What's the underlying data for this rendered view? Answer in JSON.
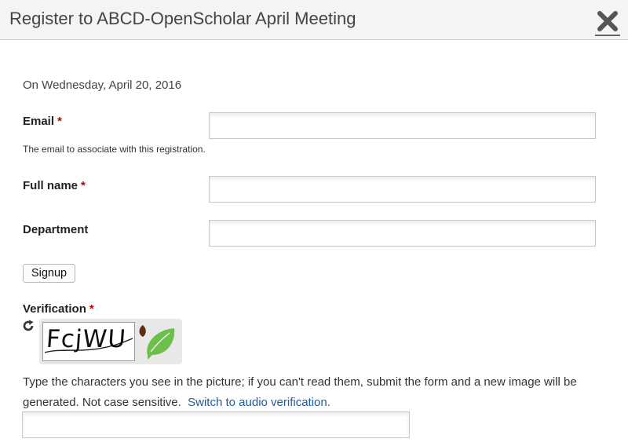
{
  "dialog": {
    "title": "Register to ABCD-OpenScholar April Meeting",
    "close_icon": "close-icon"
  },
  "event": {
    "date_line": "On Wednesday, April 20, 2016"
  },
  "form": {
    "required_marker": "*",
    "email": {
      "label": "Email",
      "required": true,
      "value": "",
      "help": "The email to associate with this registration."
    },
    "full_name": {
      "label": "Full name",
      "required": true,
      "value": ""
    },
    "department": {
      "label": "Department",
      "required": false,
      "value": ""
    },
    "signup_label": "Signup"
  },
  "verification": {
    "label": "Verification",
    "required": true,
    "refresh_icon": "refresh-icon",
    "captcha_text": "FcjWU",
    "brand_icon": "leaf-logo-icon",
    "instructions_text": "Type the characters you see in the picture; if you can't read them, submit the form and a new image will be generated. Not case sensitive.",
    "audio_link": "Switch to audio verification.",
    "answer_value": ""
  },
  "colors": {
    "required": "#c00000",
    "link": "#1f5a9b",
    "leaf_green": "#6cc04a",
    "leaf_brown": "#5a2e12"
  }
}
